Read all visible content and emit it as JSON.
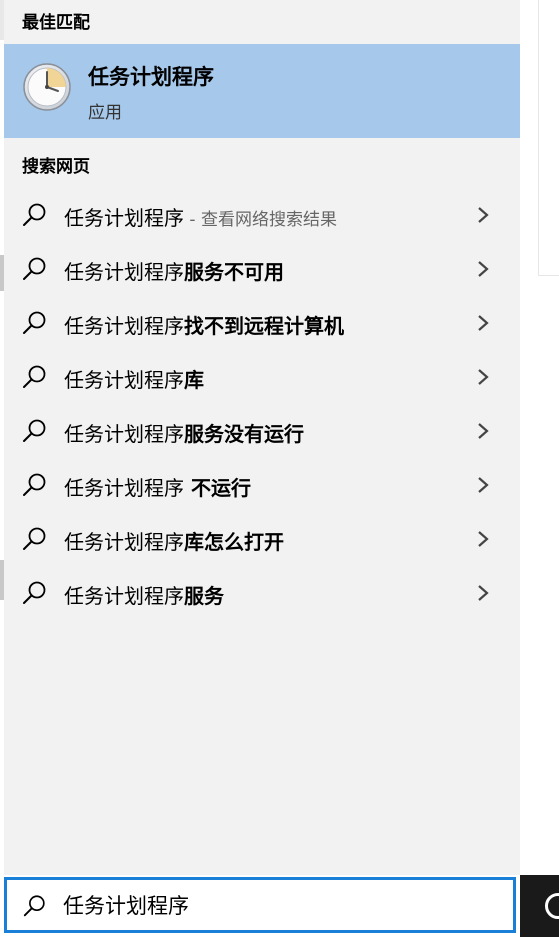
{
  "best_match": {
    "section_title": "最佳匹配",
    "app_name": "任务计划程序",
    "app_type": "应用",
    "icon": "clock-icon"
  },
  "web": {
    "section_title": "搜索网页",
    "results": [
      {
        "prefix": "任务计划程序",
        "suffix": "",
        "hint": " - 查看网络搜索结果"
      },
      {
        "prefix": "任务计划程序",
        "suffix": "服务不可用",
        "hint": ""
      },
      {
        "prefix": "任务计划程序",
        "suffix": "找不到远程计算机",
        "hint": ""
      },
      {
        "prefix": "任务计划程序",
        "suffix": "库",
        "hint": ""
      },
      {
        "prefix": "任务计划程序",
        "suffix": "服务没有运行",
        "hint": ""
      },
      {
        "prefix": "任务计划程序",
        "suffix": " 不运行",
        "hint": ""
      },
      {
        "prefix": "任务计划程序",
        "suffix": "库怎么打开",
        "hint": ""
      },
      {
        "prefix": "任务计划程序",
        "suffix": "服务",
        "hint": ""
      }
    ]
  },
  "search": {
    "value": "任务计划程序"
  },
  "colors": {
    "panel_bg": "#f2f2f2",
    "selected_bg": "#a6c8ea",
    "search_border": "#1a7fd6"
  }
}
